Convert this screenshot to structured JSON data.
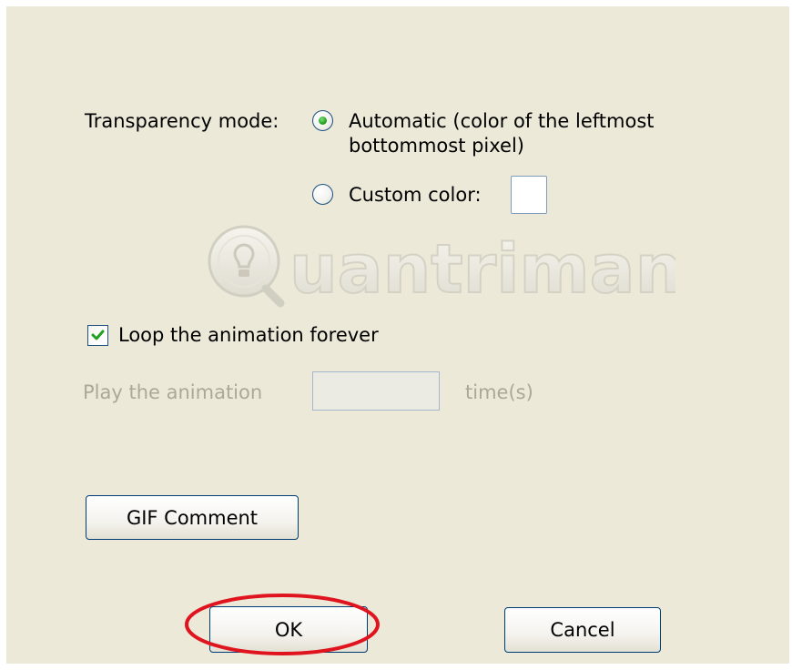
{
  "transparency": {
    "label": "Transparency mode:",
    "automatic_line1": "Automatic (color of the leftmost",
    "automatic_line2": "bottommost pixel)",
    "automatic_selected": true,
    "custom_label": "Custom color:",
    "custom_selected": false,
    "custom_color": "#ffffff"
  },
  "watermark": {
    "text": "uantrimang"
  },
  "loop": {
    "label": "Loop the animation forever",
    "checked": true
  },
  "play": {
    "prefix": "Play the animation",
    "value": "",
    "suffix": "time(s)"
  },
  "buttons": {
    "gif_comment": "GIF Comment",
    "ok": "OK",
    "cancel": "Cancel"
  },
  "colors": {
    "dialog_bg": "#ece9d8",
    "radio_selected": "#21a121",
    "check_mark": "#21a121",
    "highlight": "#e0141e",
    "disabled_text": "#aca899"
  }
}
